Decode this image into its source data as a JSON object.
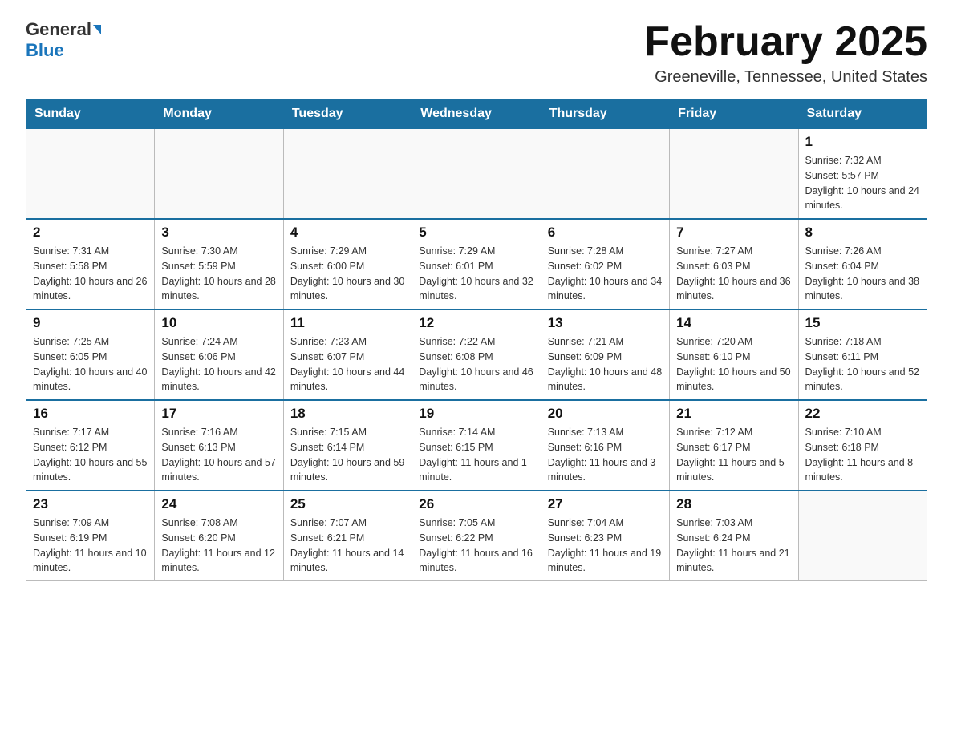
{
  "header": {
    "logo_general": "General",
    "logo_blue": "Blue",
    "month_title": "February 2025",
    "location": "Greeneville, Tennessee, United States"
  },
  "weekdays": [
    "Sunday",
    "Monday",
    "Tuesday",
    "Wednesday",
    "Thursday",
    "Friday",
    "Saturday"
  ],
  "weeks": [
    {
      "days": [
        {
          "num": "",
          "sunrise": "",
          "sunset": "",
          "daylight": ""
        },
        {
          "num": "",
          "sunrise": "",
          "sunset": "",
          "daylight": ""
        },
        {
          "num": "",
          "sunrise": "",
          "sunset": "",
          "daylight": ""
        },
        {
          "num": "",
          "sunrise": "",
          "sunset": "",
          "daylight": ""
        },
        {
          "num": "",
          "sunrise": "",
          "sunset": "",
          "daylight": ""
        },
        {
          "num": "",
          "sunrise": "",
          "sunset": "",
          "daylight": ""
        },
        {
          "num": "1",
          "sunrise": "Sunrise: 7:32 AM",
          "sunset": "Sunset: 5:57 PM",
          "daylight": "Daylight: 10 hours and 24 minutes."
        }
      ]
    },
    {
      "days": [
        {
          "num": "2",
          "sunrise": "Sunrise: 7:31 AM",
          "sunset": "Sunset: 5:58 PM",
          "daylight": "Daylight: 10 hours and 26 minutes."
        },
        {
          "num": "3",
          "sunrise": "Sunrise: 7:30 AM",
          "sunset": "Sunset: 5:59 PM",
          "daylight": "Daylight: 10 hours and 28 minutes."
        },
        {
          "num": "4",
          "sunrise": "Sunrise: 7:29 AM",
          "sunset": "Sunset: 6:00 PM",
          "daylight": "Daylight: 10 hours and 30 minutes."
        },
        {
          "num": "5",
          "sunrise": "Sunrise: 7:29 AM",
          "sunset": "Sunset: 6:01 PM",
          "daylight": "Daylight: 10 hours and 32 minutes."
        },
        {
          "num": "6",
          "sunrise": "Sunrise: 7:28 AM",
          "sunset": "Sunset: 6:02 PM",
          "daylight": "Daylight: 10 hours and 34 minutes."
        },
        {
          "num": "7",
          "sunrise": "Sunrise: 7:27 AM",
          "sunset": "Sunset: 6:03 PM",
          "daylight": "Daylight: 10 hours and 36 minutes."
        },
        {
          "num": "8",
          "sunrise": "Sunrise: 7:26 AM",
          "sunset": "Sunset: 6:04 PM",
          "daylight": "Daylight: 10 hours and 38 minutes."
        }
      ]
    },
    {
      "days": [
        {
          "num": "9",
          "sunrise": "Sunrise: 7:25 AM",
          "sunset": "Sunset: 6:05 PM",
          "daylight": "Daylight: 10 hours and 40 minutes."
        },
        {
          "num": "10",
          "sunrise": "Sunrise: 7:24 AM",
          "sunset": "Sunset: 6:06 PM",
          "daylight": "Daylight: 10 hours and 42 minutes."
        },
        {
          "num": "11",
          "sunrise": "Sunrise: 7:23 AM",
          "sunset": "Sunset: 6:07 PM",
          "daylight": "Daylight: 10 hours and 44 minutes."
        },
        {
          "num": "12",
          "sunrise": "Sunrise: 7:22 AM",
          "sunset": "Sunset: 6:08 PM",
          "daylight": "Daylight: 10 hours and 46 minutes."
        },
        {
          "num": "13",
          "sunrise": "Sunrise: 7:21 AM",
          "sunset": "Sunset: 6:09 PM",
          "daylight": "Daylight: 10 hours and 48 minutes."
        },
        {
          "num": "14",
          "sunrise": "Sunrise: 7:20 AM",
          "sunset": "Sunset: 6:10 PM",
          "daylight": "Daylight: 10 hours and 50 minutes."
        },
        {
          "num": "15",
          "sunrise": "Sunrise: 7:18 AM",
          "sunset": "Sunset: 6:11 PM",
          "daylight": "Daylight: 10 hours and 52 minutes."
        }
      ]
    },
    {
      "days": [
        {
          "num": "16",
          "sunrise": "Sunrise: 7:17 AM",
          "sunset": "Sunset: 6:12 PM",
          "daylight": "Daylight: 10 hours and 55 minutes."
        },
        {
          "num": "17",
          "sunrise": "Sunrise: 7:16 AM",
          "sunset": "Sunset: 6:13 PM",
          "daylight": "Daylight: 10 hours and 57 minutes."
        },
        {
          "num": "18",
          "sunrise": "Sunrise: 7:15 AM",
          "sunset": "Sunset: 6:14 PM",
          "daylight": "Daylight: 10 hours and 59 minutes."
        },
        {
          "num": "19",
          "sunrise": "Sunrise: 7:14 AM",
          "sunset": "Sunset: 6:15 PM",
          "daylight": "Daylight: 11 hours and 1 minute."
        },
        {
          "num": "20",
          "sunrise": "Sunrise: 7:13 AM",
          "sunset": "Sunset: 6:16 PM",
          "daylight": "Daylight: 11 hours and 3 minutes."
        },
        {
          "num": "21",
          "sunrise": "Sunrise: 7:12 AM",
          "sunset": "Sunset: 6:17 PM",
          "daylight": "Daylight: 11 hours and 5 minutes."
        },
        {
          "num": "22",
          "sunrise": "Sunrise: 7:10 AM",
          "sunset": "Sunset: 6:18 PM",
          "daylight": "Daylight: 11 hours and 8 minutes."
        }
      ]
    },
    {
      "days": [
        {
          "num": "23",
          "sunrise": "Sunrise: 7:09 AM",
          "sunset": "Sunset: 6:19 PM",
          "daylight": "Daylight: 11 hours and 10 minutes."
        },
        {
          "num": "24",
          "sunrise": "Sunrise: 7:08 AM",
          "sunset": "Sunset: 6:20 PM",
          "daylight": "Daylight: 11 hours and 12 minutes."
        },
        {
          "num": "25",
          "sunrise": "Sunrise: 7:07 AM",
          "sunset": "Sunset: 6:21 PM",
          "daylight": "Daylight: 11 hours and 14 minutes."
        },
        {
          "num": "26",
          "sunrise": "Sunrise: 7:05 AM",
          "sunset": "Sunset: 6:22 PM",
          "daylight": "Daylight: 11 hours and 16 minutes."
        },
        {
          "num": "27",
          "sunrise": "Sunrise: 7:04 AM",
          "sunset": "Sunset: 6:23 PM",
          "daylight": "Daylight: 11 hours and 19 minutes."
        },
        {
          "num": "28",
          "sunrise": "Sunrise: 7:03 AM",
          "sunset": "Sunset: 6:24 PM",
          "daylight": "Daylight: 11 hours and 21 minutes."
        },
        {
          "num": "",
          "sunrise": "",
          "sunset": "",
          "daylight": ""
        }
      ]
    }
  ]
}
